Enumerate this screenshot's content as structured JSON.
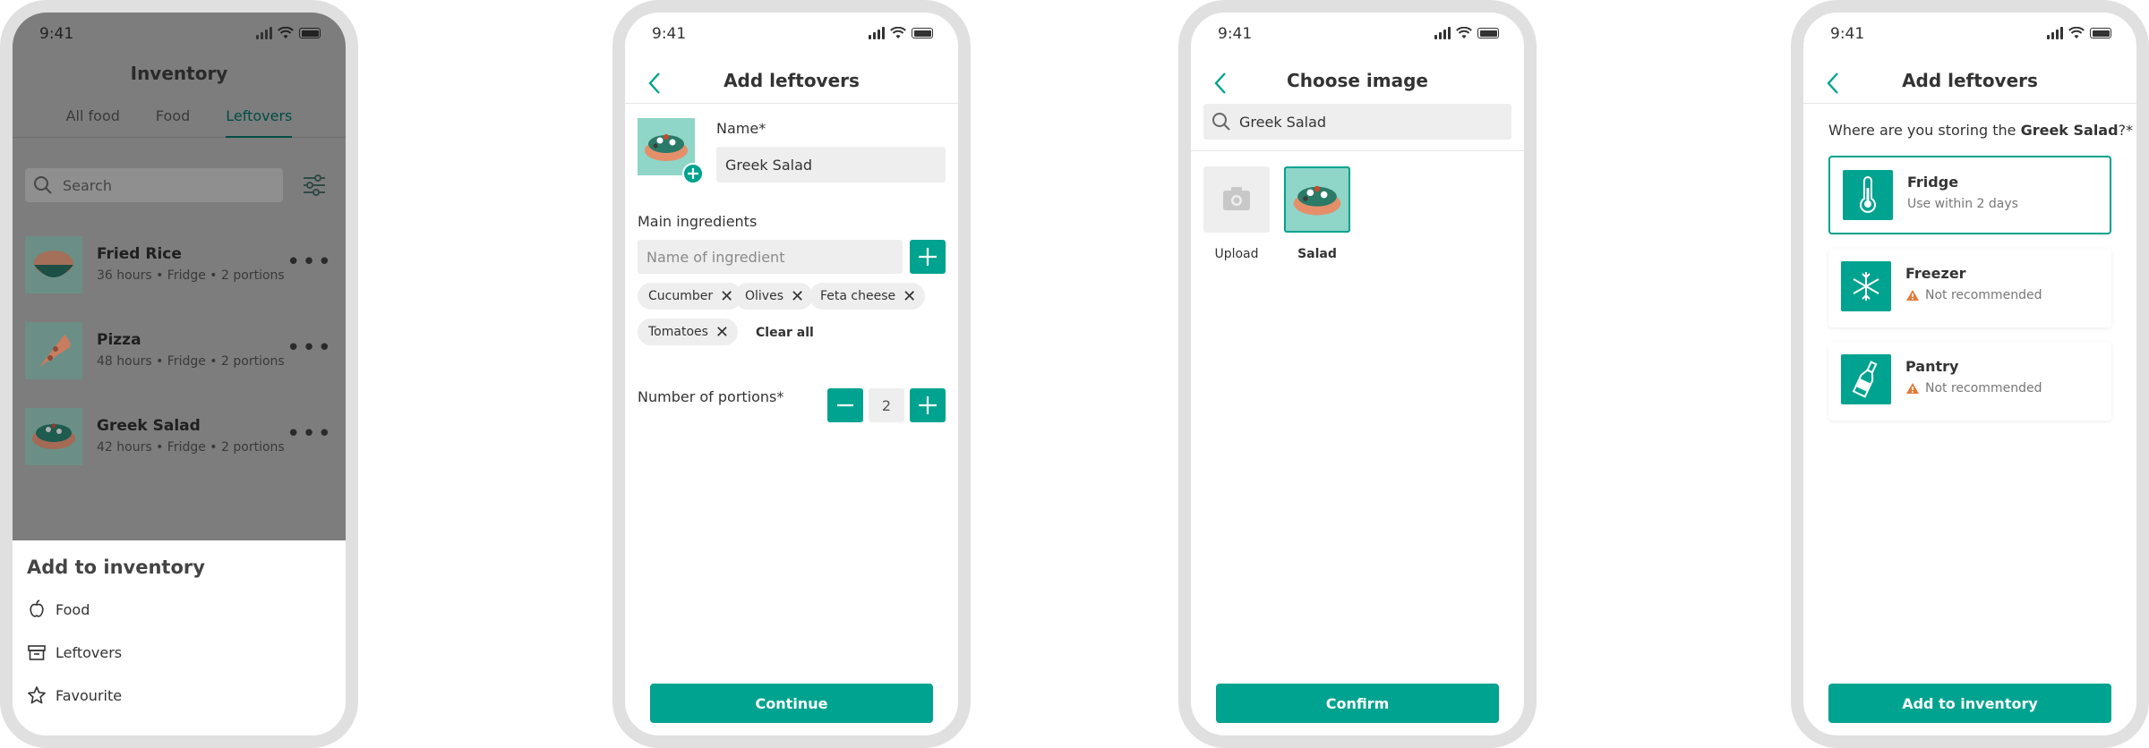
{
  "status": {
    "time": "9:41"
  },
  "screen1": {
    "title": "Inventory",
    "tabs": [
      "All food",
      "Food",
      "Leftovers"
    ],
    "active_tab": "Leftovers",
    "search_placeholder": "Search",
    "items": [
      {
        "name": "Fried Rice",
        "meta": "36 hours • Fridge • 2 portions"
      },
      {
        "name": "Pizza",
        "meta": "48 hours • Fridge • 2 portions"
      },
      {
        "name": "Greek Salad",
        "meta": "42 hours • Fridge • 2 portions"
      }
    ],
    "sheet": {
      "title": "Add to inventory",
      "options": [
        {
          "label": "Food",
          "icon": "apple-icon"
        },
        {
          "label": "Leftovers",
          "icon": "box-icon"
        },
        {
          "label": "Favourite",
          "icon": "star-icon"
        }
      ]
    },
    "colors": {
      "overlay": "#7d7d7d",
      "active_tab": "#004d45"
    }
  },
  "screen2": {
    "title": "Add leftovers",
    "name_label": "Name*",
    "name_value": "Greek Salad",
    "ingredients_label": "Main ingredients",
    "ingredient_placeholder": "Name of ingredient",
    "chips": [
      "Cucumber",
      "Olives",
      "Feta cheese",
      "Tomatoes"
    ],
    "clear_all": "Clear all",
    "portions_label": "Number of portions*",
    "portions_value": "2",
    "continue": "Continue"
  },
  "screen3": {
    "title": "Choose image",
    "search_value": "Greek Salad",
    "tiles": [
      {
        "label": "Upload",
        "icon": "camera-icon",
        "selected": false
      },
      {
        "label": "Salad",
        "icon": "salad-icon",
        "selected": true
      }
    ],
    "confirm": "Confirm"
  },
  "screen4": {
    "title": "Add leftovers",
    "question_prefix": "Where are you storing the ",
    "question_item": "Greek Salad",
    "question_suffix": "?*",
    "options": [
      {
        "title": "Fridge",
        "sub": "Use within 2 days",
        "icon": "thermometer-icon",
        "selected": true,
        "warning": false
      },
      {
        "title": "Freezer",
        "sub": "Not recommended",
        "icon": "snowflake-icon",
        "selected": false,
        "warning": true
      },
      {
        "title": "Pantry",
        "sub": "Not recommended",
        "icon": "bottle-icon",
        "selected": false,
        "warning": true
      }
    ],
    "add": "Add to inventory"
  },
  "accent": "#00a38f"
}
